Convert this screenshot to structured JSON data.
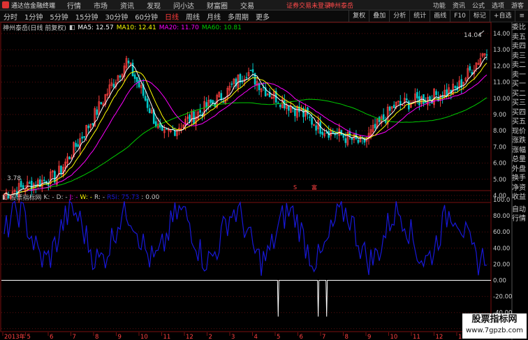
{
  "titlebar": {
    "app_title": "通达信金融终端",
    "menus": [
      "行情",
      "市场",
      "资讯",
      "发现",
      "问小达",
      "财富圈",
      "交易"
    ],
    "warning": "证券交易未登录",
    "stock": "神州泰岳",
    "right_items": [
      "功能",
      "资讯",
      "公式",
      "选项",
      "游客"
    ]
  },
  "toolbar": {
    "periods": [
      "分时",
      "1分钟",
      "5分钟",
      "15分钟",
      "30分钟",
      "60分钟",
      "日线",
      "周线",
      "月线",
      "多周期",
      "更多"
    ],
    "active_period": "日线",
    "tools": [
      "复权",
      "叠加",
      "分析",
      "统计",
      "画线",
      "F10",
      "标记",
      "+自选",
      "≡"
    ]
  },
  "main_info": {
    "name": "神州泰岳(日线 前复权)",
    "ma5": "MA5: 12.57",
    "ma10": "MA10: 12.41",
    "ma20": "MA20: 11.70",
    "ma60": "MA60: 10.81"
  },
  "colors": {
    "ma5": "#ffffff",
    "ma10": "#ffff00",
    "ma20": "#ff00ff",
    "ma60": "#00cc00",
    "up": "#ff4040",
    "down": "#00c8c8",
    "kdj": "#1818d8"
  },
  "price_axis": {
    "ticks": [
      "14.00",
      "13.00",
      "12.00",
      "11.00",
      "10.00",
      "9.00",
      "8.00",
      "7.00",
      "6.00",
      "5.00",
      "4.00"
    ],
    "high_label": "14.04",
    "low_label": "3.78"
  },
  "ind_info": {
    "title": "股票指标网",
    "k": "K: -",
    "d": "D: -",
    "j": "J: -",
    "w": "W: -",
    "r": "R: -",
    "rsi": "RSI: 75.73",
    "val": ": 0.00"
  },
  "ind_axis": {
    "ticks": [
      "100.0",
      "80.00",
      "60.00",
      "40.00",
      "20.00",
      "0.00",
      "-20.00",
      "-40.00",
      "-60.00"
    ]
  },
  "markers": {
    "s1": "S",
    "s2": "S",
    "s3": "富"
  },
  "date_axis": [
    "2013年",
    "5",
    "6",
    "7",
    "8",
    "9",
    "10",
    "11",
    "12",
    "2",
    "3",
    "4",
    "5",
    "6",
    "7",
    "8",
    "9",
    "10",
    "11",
    "12",
    "1"
  ],
  "sidebar": [
    "委比",
    "卖五",
    "卖四",
    "卖三",
    "卖二",
    "卖一",
    "买一",
    "买二",
    "买三",
    "买四",
    "买五",
    "现价",
    "涨跌",
    "涨幅",
    "总量",
    "外盘",
    "换手",
    "净资",
    "收益",
    "自动",
    "行情"
  ],
  "watermark": {
    "line1": "股票指标网",
    "line2": "www.7gpzb.com"
  }
}
